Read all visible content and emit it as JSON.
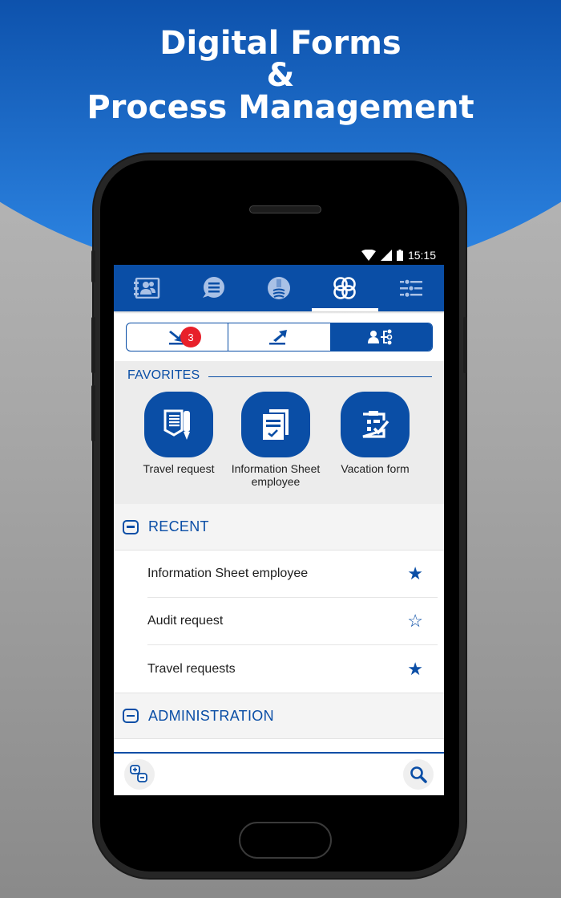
{
  "headline": {
    "line1": "Digital Forms",
    "line2": "&",
    "line3": "Process Management"
  },
  "statusbar": {
    "time": "15:15",
    "icons": [
      "wifi-icon",
      "signal-icon",
      "battery-icon"
    ]
  },
  "topnav": {
    "tabs": [
      {
        "icon": "contacts-book-icon",
        "active": false
      },
      {
        "icon": "chat-list-icon",
        "active": false
      },
      {
        "icon": "thumbs-up-icon",
        "active": false
      },
      {
        "icon": "workflow-rings-icon",
        "active": true
      },
      {
        "icon": "sliders-settings-icon",
        "active": false
      }
    ]
  },
  "segments": [
    {
      "icon": "inbox-arrow-icon",
      "badge": "3",
      "active": false
    },
    {
      "icon": "outbox-arrow-icon",
      "active": false
    },
    {
      "icon": "org-process-icon",
      "active": true
    }
  ],
  "favorites": {
    "title": "FAVORITES",
    "items": [
      {
        "label": "Travel request",
        "icon": "form-pen-icon"
      },
      {
        "label": "Information Sheet employee",
        "icon": "documents-check-icon"
      },
      {
        "label": "Vacation form",
        "icon": "clipboard-check-icon"
      }
    ]
  },
  "recent": {
    "title": "RECENT",
    "items": [
      {
        "label": "Information Sheet employee",
        "starred": true,
        "star": "★"
      },
      {
        "label": "Audit request",
        "starred": false,
        "star": "☆"
      },
      {
        "label": "Travel requests",
        "starred": true,
        "star": "★"
      }
    ]
  },
  "administration": {
    "title": "ADMINISTRATION"
  },
  "bottom_bar": {
    "left_icon": "expand-collapse-icon",
    "right_icon": "search-icon"
  },
  "colors": {
    "brand_blue": "#0a4ea6",
    "badge_red": "#e8202a"
  }
}
